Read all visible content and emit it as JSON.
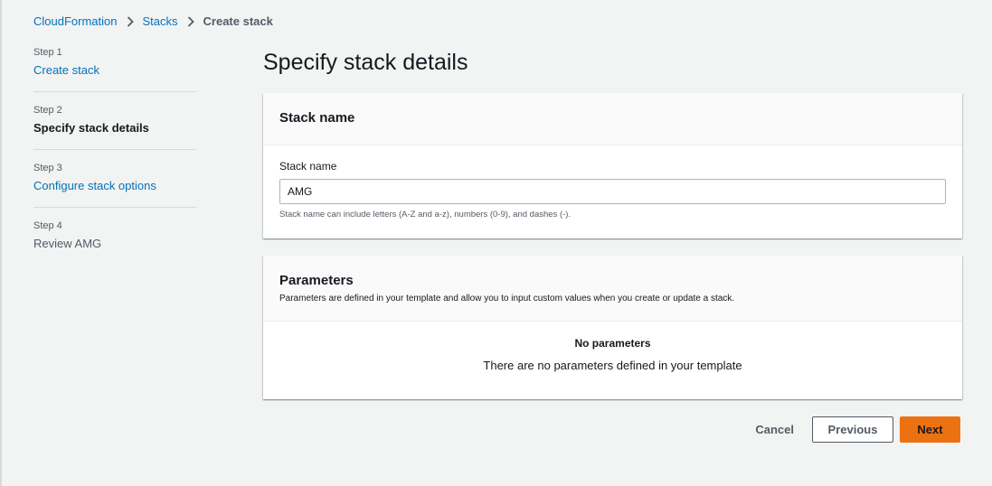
{
  "breadcrumb": {
    "items": [
      "CloudFormation",
      "Stacks"
    ],
    "current": "Create stack"
  },
  "steps": [
    {
      "num": "Step 1",
      "label": "Create stack"
    },
    {
      "num": "Step 2",
      "label": "Specify stack details"
    },
    {
      "num": "Step 3",
      "label": "Configure stack options"
    },
    {
      "num": "Step 4",
      "label": "Review AMG"
    }
  ],
  "page_title": "Specify stack details",
  "stack_name_panel": {
    "header": "Stack name",
    "field_label": "Stack name",
    "value": "AMG",
    "hint": "Stack name can include letters (A-Z and a-z), numbers (0-9), and dashes (-)."
  },
  "parameters_panel": {
    "header": "Parameters",
    "description": "Parameters are defined in your template and allow you to input custom values when you create or update a stack.",
    "empty_title": "No parameters",
    "empty_desc": "There are no parameters defined in your template"
  },
  "actions": {
    "cancel": "Cancel",
    "previous": "Previous",
    "next": "Next"
  },
  "colors": {
    "link": "#0073bb",
    "primary": "#ec7211",
    "background": "#f2f3f3"
  }
}
